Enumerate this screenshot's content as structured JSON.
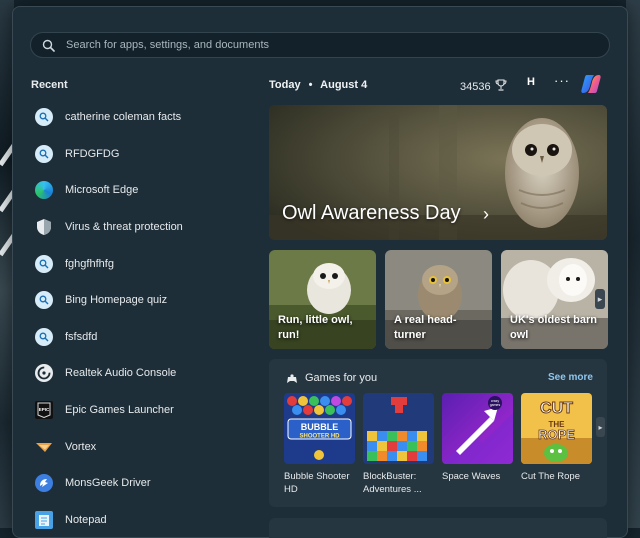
{
  "search": {
    "placeholder": "Search for apps, settings, and documents"
  },
  "recent": {
    "title": "Recent",
    "items": [
      {
        "label": "catherine coleman facts",
        "icon": "search-icon"
      },
      {
        "label": "RFDGFDG",
        "icon": "search-icon"
      },
      {
        "label": "Microsoft Edge",
        "icon": "edge-icon"
      },
      {
        "label": "Virus & threat protection",
        "icon": "shield-icon"
      },
      {
        "label": "fghgfhfhfg",
        "icon": "search-icon"
      },
      {
        "label": "Bing Homepage quiz",
        "icon": "search-icon"
      },
      {
        "label": "fsfsdfd",
        "icon": "search-icon"
      },
      {
        "label": "Realtek Audio Console",
        "icon": "realtek-icon"
      },
      {
        "label": "Epic Games Launcher",
        "icon": "epic-games-icon"
      },
      {
        "label": "Vortex",
        "icon": "vortex-icon"
      },
      {
        "label": "MonsGeek Driver",
        "icon": "monsgeek-icon"
      },
      {
        "label": "Notepad",
        "icon": "notepad-icon"
      }
    ]
  },
  "header": {
    "today": "Today",
    "separator": "•",
    "date": "August 4",
    "points": "34536",
    "user_initial": "H",
    "more": "···"
  },
  "hero": {
    "title": "Owl Awareness Day",
    "chevron": "›"
  },
  "cards": [
    {
      "text": "Run, little owl, run!"
    },
    {
      "text": "A real head-turner"
    },
    {
      "text": "UK's oldest barn owl"
    }
  ],
  "games": {
    "title": "Games for you",
    "see_more": "See more",
    "items": [
      {
        "name": "Bubble Shooter HD",
        "thumb_text": "BUBBLE SHOOTER HD"
      },
      {
        "name": "BlockBuster: Adventures ...",
        "thumb_text": ""
      },
      {
        "name": "Space Waves",
        "thumb_text": "crazy games"
      },
      {
        "name": "Cut The Rope",
        "thumb_text": "CUT THE ROPE"
      }
    ]
  },
  "colors": {
    "panel": "#1e2e38",
    "accent_link": "#8fc6ee",
    "search_icon_bg": "#d6ecf8"
  }
}
